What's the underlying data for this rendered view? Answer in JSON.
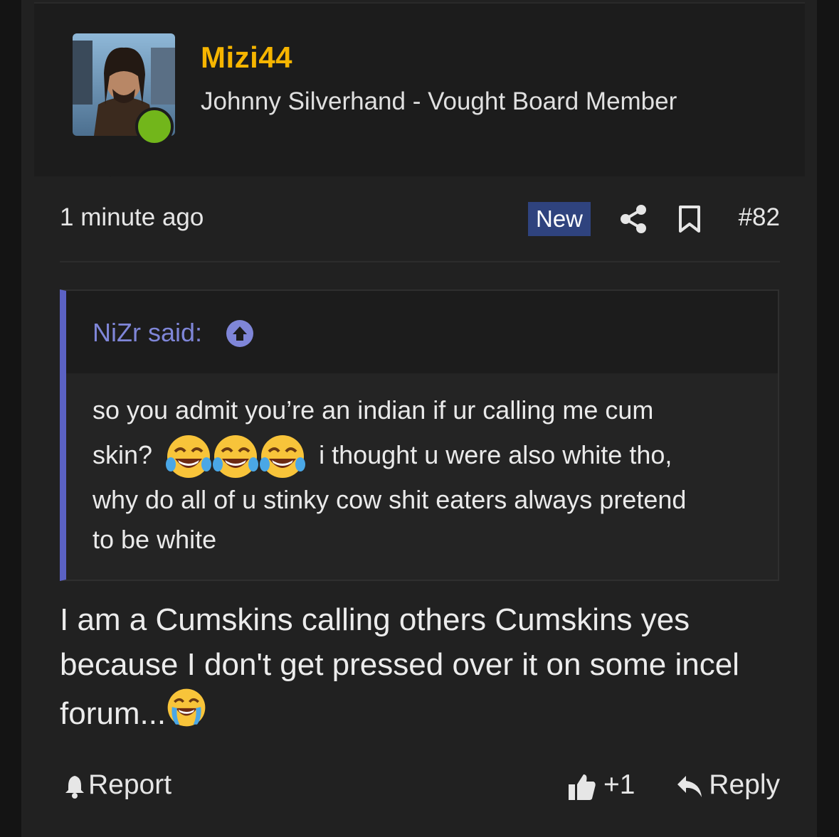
{
  "user": {
    "name": "Mizi44",
    "title": "Johnny Silverhand - Vought Board Member",
    "avatar_alt": "avatar",
    "online": true
  },
  "meta": {
    "time": "1 minute ago",
    "badge": "New",
    "post_number": "#82"
  },
  "quote": {
    "author": "NiZr said:",
    "line1": "so you admit you’re an indian if ur calling me cum",
    "line2_start": "skin?",
    "line2_end": "i thought u were also white tho,",
    "line3": "why do all of u stinky cow shit eaters always pretend",
    "line4": "to be white"
  },
  "body": {
    "line1": "I am a Cumskins calling others Cumskins yes",
    "line2": "because I don't get pressed over it on some incel",
    "line3": "forum..."
  },
  "actions": {
    "report": "Report",
    "likes": "+1",
    "reply": "Reply"
  },
  "colors": {
    "username": "#f6b500",
    "badge": "#2f437e",
    "quote_accent": "#5b62c4",
    "online": "#72b61b"
  }
}
